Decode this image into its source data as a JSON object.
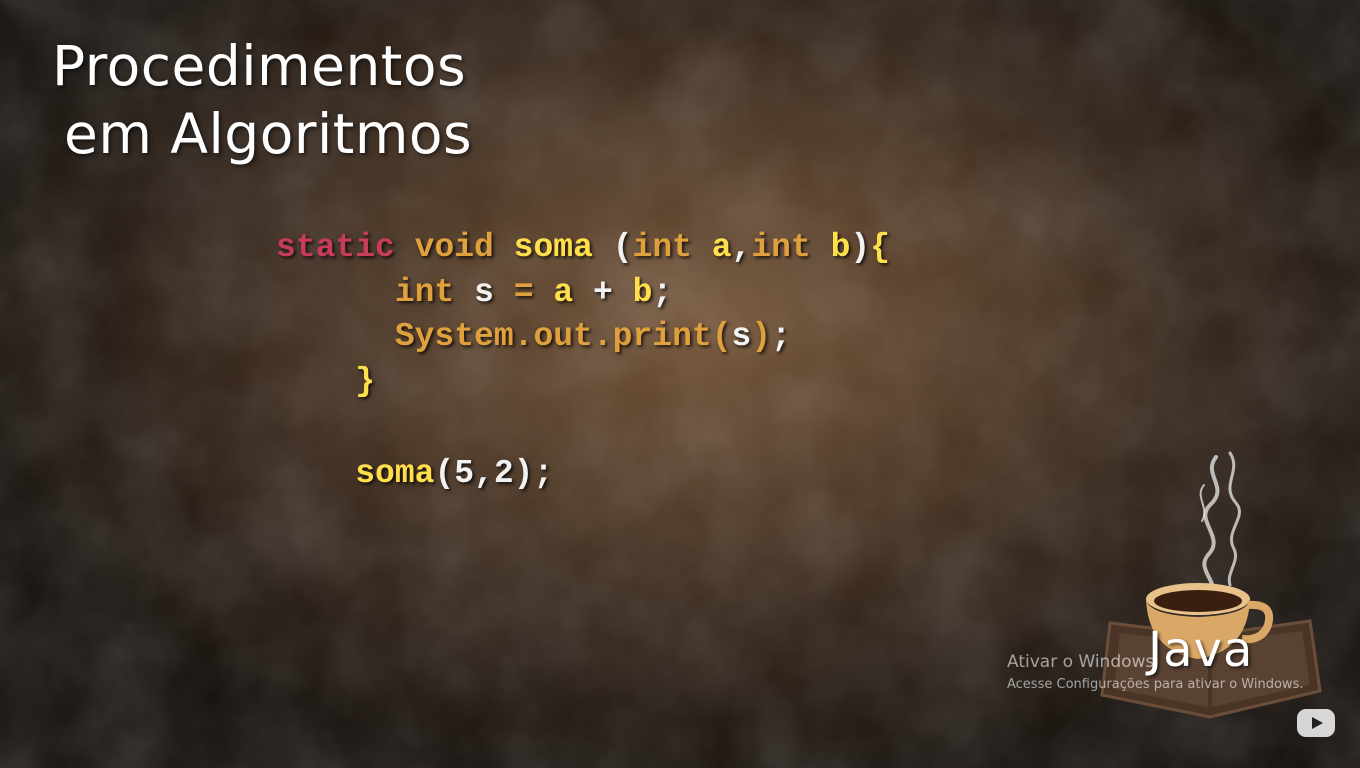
{
  "slide": {
    "title_line1": "Procedimentos",
    "title_line2": "em Algoritmos"
  },
  "code": {
    "line1": {
      "static": "static",
      "void": "void",
      "name": "soma",
      "paren_open": "(",
      "int1": "int",
      "a": "a",
      "comma": ",",
      "int2": "int",
      "b": "b",
      "paren_close": ")",
      "brace": "{"
    },
    "line2": {
      "int": "int",
      "s": "s",
      "eq": "=",
      "a": "a",
      "plus": "+",
      "b": "b",
      "semi": ";"
    },
    "line3": {
      "call": "System.out.print",
      "paren_open": "(",
      "arg": "s",
      "paren_close": ")",
      "semi": ";"
    },
    "line4": {
      "brace": "}"
    },
    "line5": {
      "name": "soma",
      "paren_open": "(",
      "args": "5,2",
      "paren_close": ")",
      "semi": ";"
    }
  },
  "logo": {
    "text": "Java",
    "icon": "java-coffee-cup-icon"
  },
  "watermark": {
    "title": "Ativar o Windows",
    "subtitle": "Acesse Configurações para ativar o Windows."
  },
  "player": {
    "icon": "youtube-play-icon"
  },
  "colors": {
    "keyword_red": "#c63c5a",
    "keyword_orange": "#e0a13c",
    "identifier_yellow": "#ffe04a",
    "plain_white": "#f2f2f2"
  }
}
